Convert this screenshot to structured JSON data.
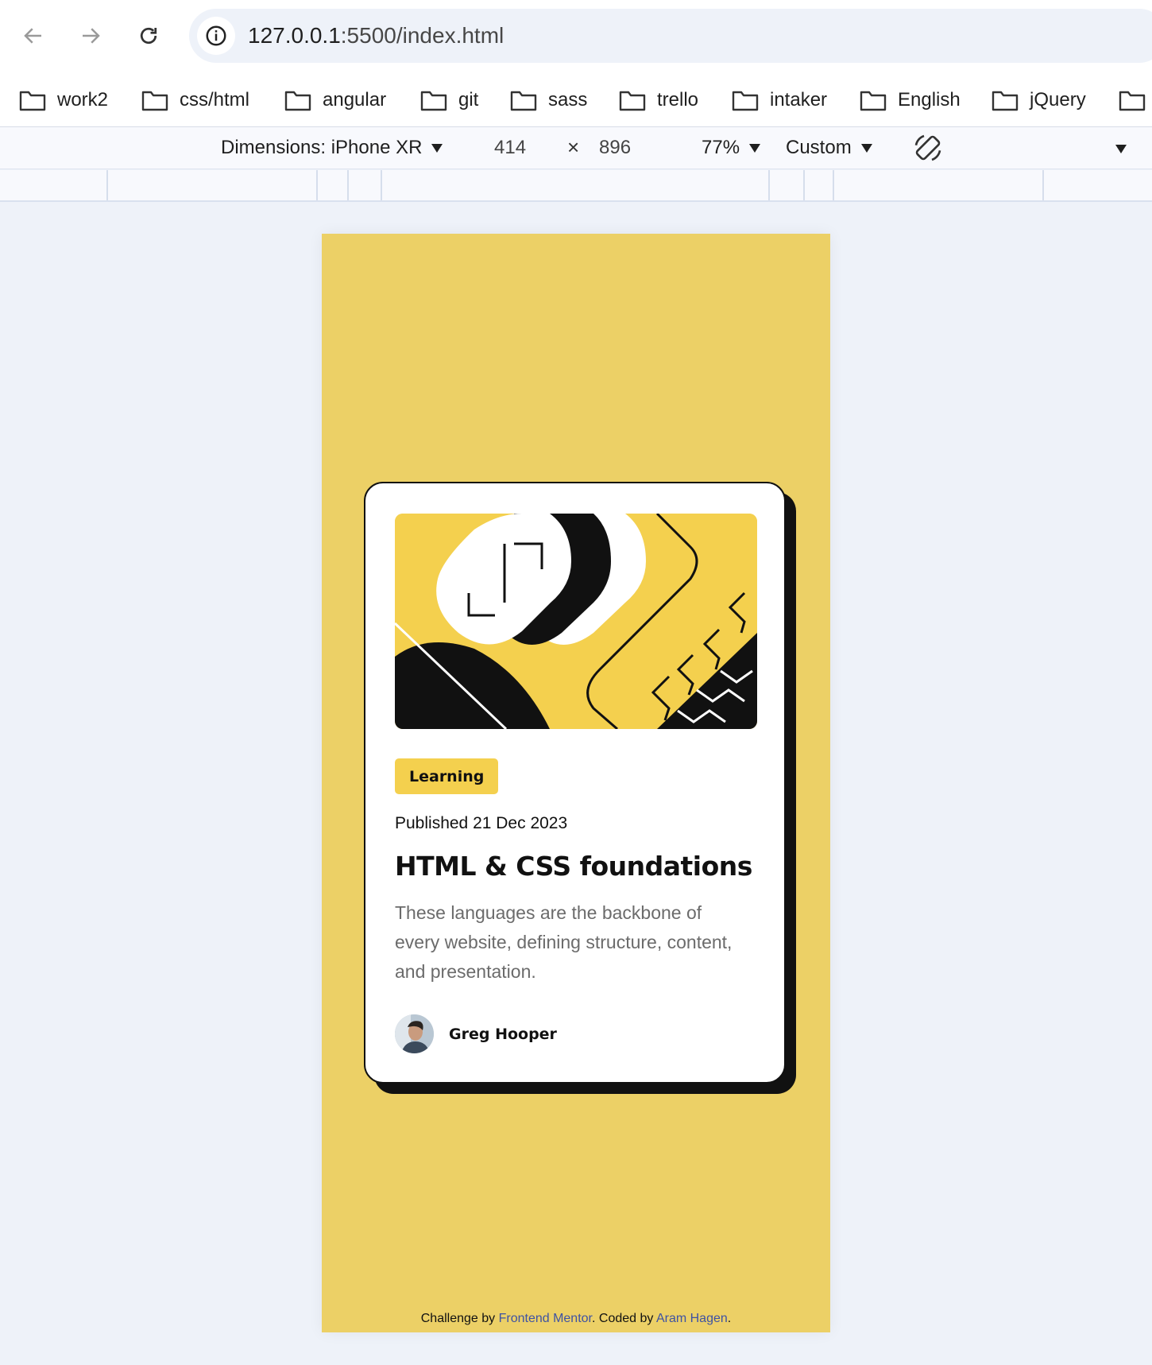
{
  "browser": {
    "url_host": "127.0.0.1",
    "url_path": ":5500/index.html",
    "nav": {
      "back_icon": "arrow-left-icon",
      "forward_icon": "arrow-right-icon",
      "reload_icon": "reload-icon",
      "info_icon": "info-icon"
    }
  },
  "bookmarks": [
    {
      "label": "work2"
    },
    {
      "label": "css/html"
    },
    {
      "label": "angular"
    },
    {
      "label": "git"
    },
    {
      "label": "sass"
    },
    {
      "label": "trello"
    },
    {
      "label": "intaker"
    },
    {
      "label": "English"
    },
    {
      "label": "jQuery"
    },
    {
      "label": ""
    }
  ],
  "device_toolbar": {
    "dimensions_label": "Dimensions: iPhone XR",
    "width": "414",
    "times": "×",
    "height": "896",
    "zoom": "77%",
    "throttle": "Custom"
  },
  "card": {
    "tag": "Learning",
    "published": "Published 21 Dec 2023",
    "title": "HTML & CSS foundations",
    "description": "These languages are the backbone of every website, defining structure, content, and presentation.",
    "author": "Greg Hooper"
  },
  "footer": {
    "prefix": "Challenge by ",
    "link1": "Frontend Mentor",
    "middle": ". Coded by ",
    "link2": "Aram Hagen",
    "suffix": "."
  },
  "colors": {
    "page_background": "#ecd066",
    "accent_yellow": "#f4d04e",
    "ink": "#111111",
    "link": "#3e52a3"
  }
}
